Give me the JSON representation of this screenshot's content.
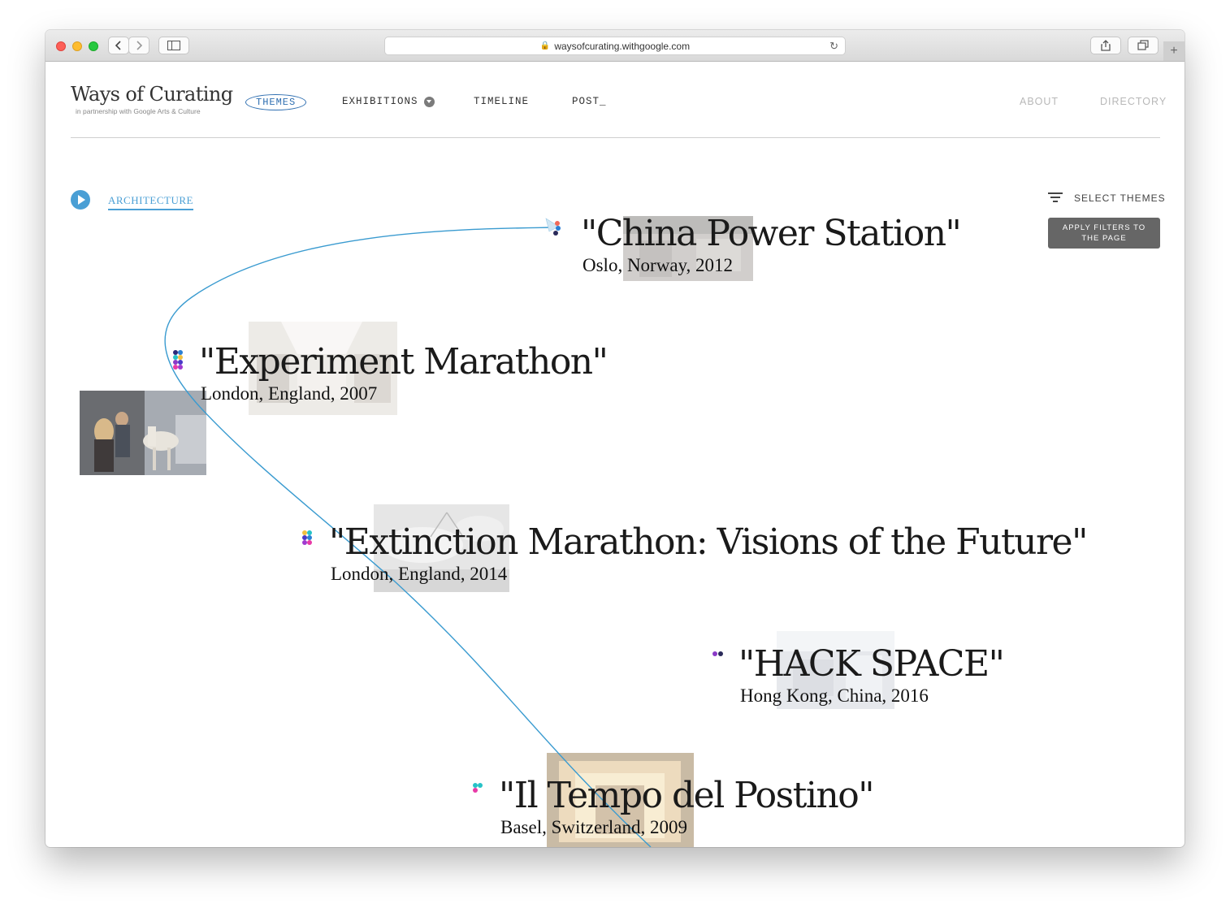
{
  "browser": {
    "url": "waysofcurating.withgoogle.com",
    "plus": "+"
  },
  "logo": {
    "title": "Ways of Curating",
    "subtitle": "in partnership with Google Arts & Culture"
  },
  "nav": {
    "themes": "THEMES",
    "exhibitions": "EXHIBITIONS",
    "timeline": "TIMELINE",
    "post": "POST_",
    "about": "ABOUT",
    "directory": "DIRECTORY"
  },
  "theme": {
    "active": "ARCHITECTURE"
  },
  "filters": {
    "select_label": "SELECT THEMES",
    "apply_label": "APPLY FILTERS TO THE PAGE"
  },
  "colors": {
    "accent": "#4a9fd5",
    "curve": "#3a9bd0",
    "button": "#666666"
  },
  "exhibitions": [
    {
      "title": "\"China Power Station\"",
      "subtitle": "Oslo, Norway, 2012"
    },
    {
      "title": "\"Experiment Marathon\"",
      "subtitle": "London, England, 2007"
    },
    {
      "title": "\"Extinction Marathon: Visions of the Future\"",
      "subtitle": "London, England, 2014"
    },
    {
      "title": "\"HACK SPACE\"",
      "subtitle": "Hong Kong, China, 2016"
    },
    {
      "title": "\"Il Tempo del Postino\"",
      "subtitle": "Basel, Switzerland, 2009"
    }
  ]
}
